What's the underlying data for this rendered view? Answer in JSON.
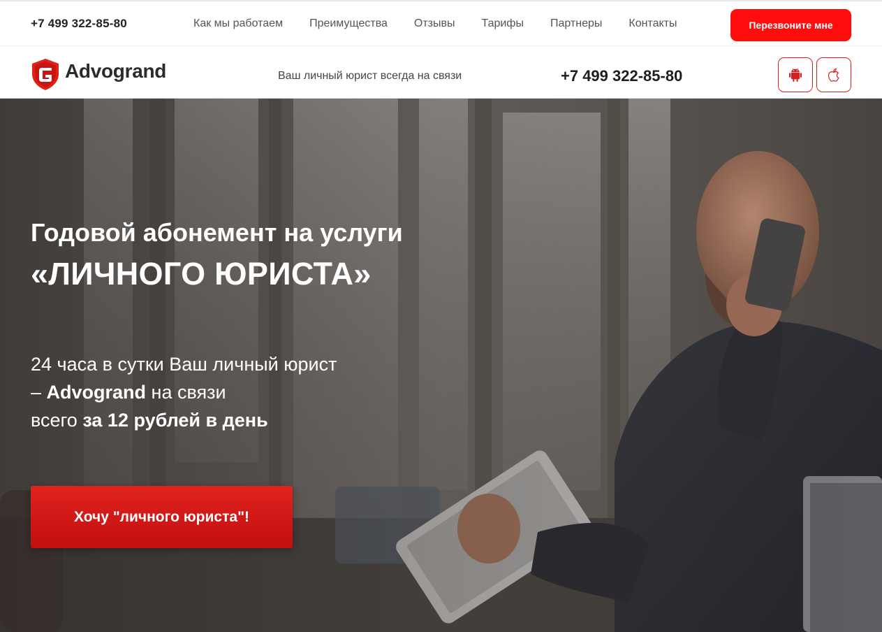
{
  "topbar": {
    "phone": "+7 499 322-85-80",
    "nav": [
      {
        "label": "Как мы работаем"
      },
      {
        "label": "Преимущества"
      },
      {
        "label": "Отзывы"
      },
      {
        "label": "Тарифы"
      },
      {
        "label": "Партнеры"
      },
      {
        "label": "Контакты"
      }
    ],
    "callback_label": "Перезвоните мне"
  },
  "header": {
    "logo_text": "Advogrand",
    "logo_icon": "shield-g-icon",
    "tagline": "Ваш личный юрист всегда на связи",
    "phone": "+7 499 322-85-80",
    "android_icon": "android-icon",
    "apple_icon": "apple-icon"
  },
  "hero": {
    "title": "Годовой абонемент на услуги",
    "title_big": "«ЛИЧНОГО ЮРИСТА»",
    "line1": "24 часа в сутки Ваш личный юрист",
    "line2_prefix": "– ",
    "line2_bold": "Advogrand",
    "line2_suffix": " на связи",
    "line3_prefix": "всего ",
    "line3_bold": "за 12 рублей в день",
    "cta_label": "Хочу \"личного юриста\"!"
  },
  "colors": {
    "accent": "#ff0d0d",
    "cta": "#d11a17",
    "text_dark": "#222222"
  }
}
